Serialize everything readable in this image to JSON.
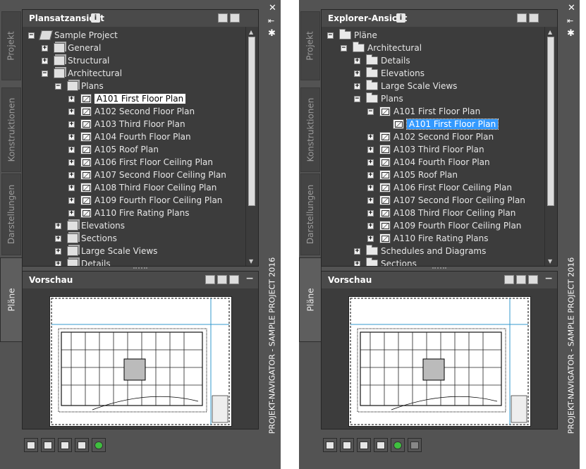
{
  "palettes": [
    {
      "tabs": [
        "Projekt",
        "Konstruktionen",
        "Darstellungen",
        "Pläne"
      ],
      "active_tab": "Pläne",
      "palette_title": "PROJEKT-NAVIGATOR - SAMPLE PROJECT 2016",
      "tree_panel": {
        "title": "Plansatzansicht",
        "rows": [
          {
            "label": "Sample Project",
            "icon": "project-icon",
            "expander": "minus",
            "indent": 0
          },
          {
            "label": "General",
            "icon": "sheet-set-icon",
            "expander": "plus",
            "indent": 1
          },
          {
            "label": "Structural",
            "icon": "sheet-set-icon",
            "expander": "plus",
            "indent": 1
          },
          {
            "label": "Architectural",
            "icon": "sheet-set-icon",
            "expander": "minus",
            "indent": 1
          },
          {
            "label": "Plans",
            "icon": "sheet-set-icon",
            "expander": "minus",
            "indent": 2
          },
          {
            "label": "A101 First Floor Plan",
            "icon": "sheet-icon",
            "expander": "plus",
            "indent": 3,
            "selected": "white"
          },
          {
            "label": "A102 Second Floor Plan",
            "icon": "sheet-icon",
            "expander": "plus",
            "indent": 3
          },
          {
            "label": "A103 Third Floor Plan",
            "icon": "sheet-icon",
            "expander": "plus",
            "indent": 3
          },
          {
            "label": "A104 Fourth Floor Plan",
            "icon": "sheet-icon",
            "expander": "plus",
            "indent": 3
          },
          {
            "label": "A105 Roof Plan",
            "icon": "sheet-icon",
            "expander": "plus",
            "indent": 3
          },
          {
            "label": "A106 First Floor Ceiling Plan",
            "icon": "sheet-icon",
            "expander": "plus",
            "indent": 3
          },
          {
            "label": "A107 Second Floor Ceiling Plan",
            "icon": "sheet-icon",
            "expander": "plus",
            "indent": 3
          },
          {
            "label": "A108 Third Floor Ceiling Plan",
            "icon": "sheet-icon",
            "expander": "plus",
            "indent": 3
          },
          {
            "label": "A109 Fourth Floor Ceiling Plan",
            "icon": "sheet-icon",
            "expander": "plus",
            "indent": 3
          },
          {
            "label": "A110 Fire Rating Plans",
            "icon": "sheet-icon",
            "expander": "plus",
            "indent": 3
          },
          {
            "label": "Elevations",
            "icon": "sheet-set-icon",
            "expander": "plus",
            "indent": 2
          },
          {
            "label": "Sections",
            "icon": "sheet-set-icon",
            "expander": "plus",
            "indent": 2
          },
          {
            "label": "Large Scale Views",
            "icon": "sheet-set-icon",
            "expander": "plus",
            "indent": 2
          },
          {
            "label": "Details",
            "icon": "sheet-set-icon",
            "expander": "plus",
            "indent": 2
          }
        ]
      },
      "preview_panel": {
        "title": "Vorschau"
      },
      "bottom_toolbar": [
        "sheet-set-properties-icon",
        "new-sheet-icon",
        "publish-icon",
        "sheet-list-table-icon",
        "refresh-icon"
      ]
    },
    {
      "tabs": [
        "Projekt",
        "Konstruktionen",
        "Darstellungen",
        "Pläne"
      ],
      "active_tab": "Pläne",
      "palette_title": "PROJEKT-NAVIGATOR - SAMPLE PROJECT 2016",
      "tree_panel": {
        "title": "Explorer-Ansicht",
        "rows": [
          {
            "label": "Pläne",
            "icon": "open-folder-icon",
            "expander": "minus",
            "indent": 0
          },
          {
            "label": "Architectural",
            "icon": "open-folder-icon",
            "expander": "minus",
            "indent": 1
          },
          {
            "label": "Details",
            "icon": "folder-icon",
            "expander": "plus",
            "indent": 2
          },
          {
            "label": "Elevations",
            "icon": "folder-icon",
            "expander": "plus",
            "indent": 2
          },
          {
            "label": "Large Scale Views",
            "icon": "folder-icon",
            "expander": "plus",
            "indent": 2
          },
          {
            "label": "Plans",
            "icon": "open-folder-icon",
            "expander": "minus",
            "indent": 2
          },
          {
            "label": "A101 First Floor Plan",
            "icon": "drawing-file-icon",
            "expander": "minus",
            "indent": 3
          },
          {
            "label": "A101 First Floor Plan",
            "icon": "sheet-icon",
            "expander": "none",
            "indent": 4,
            "selected": "blue"
          },
          {
            "label": "A102 Second Floor Plan",
            "icon": "drawing-file-icon",
            "expander": "plus",
            "indent": 3
          },
          {
            "label": "A103 Third Floor Plan",
            "icon": "drawing-file-icon",
            "expander": "plus",
            "indent": 3
          },
          {
            "label": "A104 Fourth Floor Plan",
            "icon": "drawing-file-icon",
            "expander": "plus",
            "indent": 3
          },
          {
            "label": "A105 Roof Plan",
            "icon": "drawing-file-icon",
            "expander": "plus",
            "indent": 3
          },
          {
            "label": "A106 First Floor Ceiling Plan",
            "icon": "drawing-file-icon",
            "expander": "plus",
            "indent": 3
          },
          {
            "label": "A107 Second Floor Ceiling Plan",
            "icon": "drawing-file-icon",
            "expander": "plus",
            "indent": 3
          },
          {
            "label": "A108 Third Floor Ceiling Plan",
            "icon": "drawing-file-icon",
            "expander": "plus",
            "indent": 3
          },
          {
            "label": "A109 Fourth Floor Ceiling Plan",
            "icon": "drawing-file-icon",
            "expander": "plus",
            "indent": 3
          },
          {
            "label": "A110 Fire Rating Plans",
            "icon": "drawing-file-icon",
            "expander": "plus",
            "indent": 3
          },
          {
            "label": "Schedules and Diagrams",
            "icon": "folder-icon",
            "expander": "plus",
            "indent": 2
          },
          {
            "label": "Sections",
            "icon": "folder-icon",
            "expander": "plus",
            "indent": 2
          }
        ]
      },
      "preview_panel": {
        "title": "Vorschau"
      },
      "bottom_toolbar": [
        "new-sheet-icon",
        "new-file-icon",
        "publish-icon",
        "sheet-list-table-icon",
        "refresh-icon",
        "disabled-tool-icon"
      ]
    }
  ],
  "colors": {
    "palette_bg": "#535353",
    "panel_bg": "#3c3c3c",
    "selection_blue": "#3399ff"
  }
}
